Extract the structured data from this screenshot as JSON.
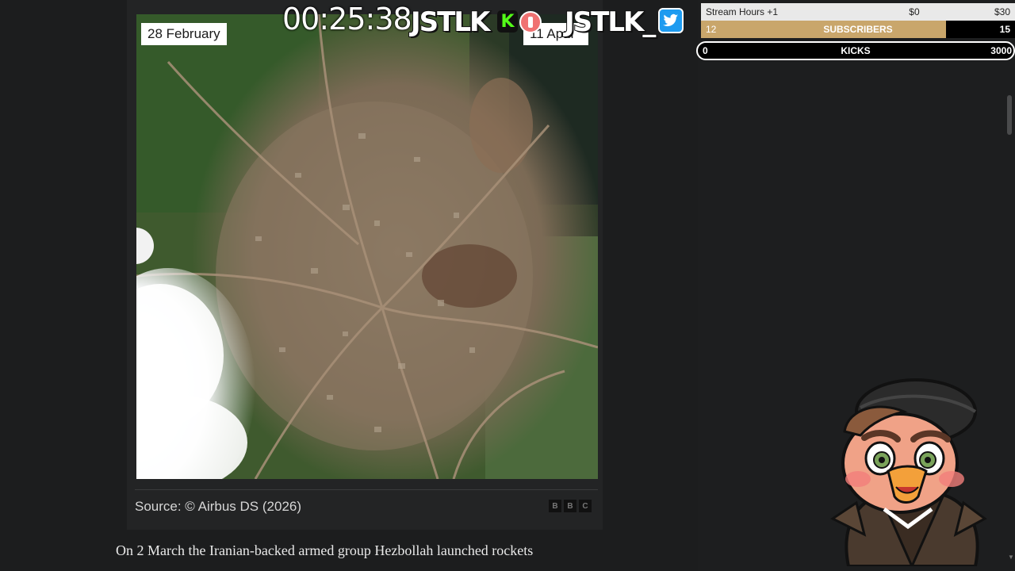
{
  "stream": {
    "timer": "00:25:38",
    "brand_left": "JSTLK",
    "brand_right": "JSTLK_"
  },
  "goals": {
    "hours": {
      "label": "Stream Hours +1",
      "current": "$0",
      "target": "$30"
    },
    "subscribers": {
      "label": "SUBSCRIBERS",
      "current": "12",
      "target": "15",
      "progress": 0.8,
      "fill_color": "#c9a66b"
    },
    "kicks": {
      "label": "KICKS",
      "current": "0",
      "target": "3000",
      "progress": 0
    }
  },
  "figure": {
    "label_left": "28 February",
    "label_right": "11 April",
    "source": "Source: © Airbus DS (2026)",
    "logo": [
      "B",
      "B",
      "C"
    ]
  },
  "article": {
    "body_line": "On 2 March the Iranian-backed armed group Hezbollah launched rockets"
  },
  "icons": {
    "kick": "kick-logo-icon",
    "record": "record-icon",
    "twitter": "twitter-bird-icon",
    "handle": "slider-handle-icon"
  }
}
